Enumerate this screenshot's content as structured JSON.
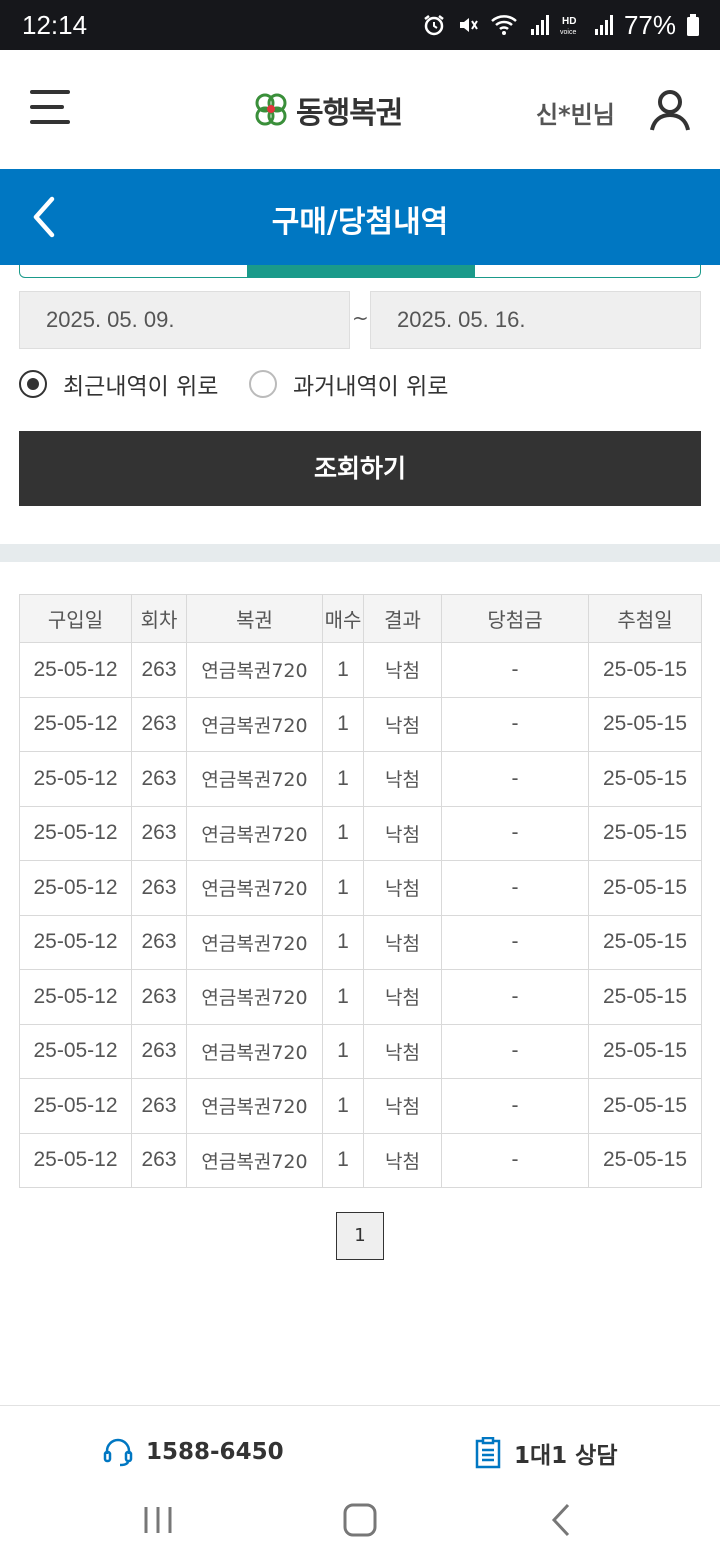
{
  "status_bar": {
    "time": "12:14",
    "battery": "77%"
  },
  "header": {
    "logo_text": "동행복권",
    "user_name": "신*빈님"
  },
  "title_bar": {
    "title": "구매/당첨내역"
  },
  "search": {
    "start_date": "2025. 05. 09.",
    "separator": "~",
    "end_date": "2025. 05. 16.",
    "sort_recent_label": "최근내역이 위로",
    "sort_past_label": "과거내역이 위로",
    "sort_selected": "recent",
    "button_label": "조회하기"
  },
  "table": {
    "headers": [
      "구입일",
      "회차",
      "복권",
      "매수",
      "결과",
      "당첨금",
      "추첨일"
    ],
    "rows": [
      [
        "25-05-12",
        "263",
        "연금복권720",
        "1",
        "낙첨",
        "-",
        "25-05-15"
      ],
      [
        "25-05-12",
        "263",
        "연금복권720",
        "1",
        "낙첨",
        "-",
        "25-05-15"
      ],
      [
        "25-05-12",
        "263",
        "연금복권720",
        "1",
        "낙첨",
        "-",
        "25-05-15"
      ],
      [
        "25-05-12",
        "263",
        "연금복권720",
        "1",
        "낙첨",
        "-",
        "25-05-15"
      ],
      [
        "25-05-12",
        "263",
        "연금복권720",
        "1",
        "낙첨",
        "-",
        "25-05-15"
      ],
      [
        "25-05-12",
        "263",
        "연금복권720",
        "1",
        "낙첨",
        "-",
        "25-05-15"
      ],
      [
        "25-05-12",
        "263",
        "연금복권720",
        "1",
        "낙첨",
        "-",
        "25-05-15"
      ],
      [
        "25-05-12",
        "263",
        "연금복권720",
        "1",
        "낙첨",
        "-",
        "25-05-15"
      ],
      [
        "25-05-12",
        "263",
        "연금복권720",
        "1",
        "낙첨",
        "-",
        "25-05-15"
      ],
      [
        "25-05-12",
        "263",
        "연금복권720",
        "1",
        "낙첨",
        "-",
        "25-05-15"
      ]
    ]
  },
  "pagination": {
    "current_page": "1"
  },
  "footer": {
    "phone": "1588-6450",
    "consult": "1대1 상담"
  },
  "icons": {
    "menu": "menu-icon",
    "user": "user-icon",
    "back": "back-icon",
    "phone": "headset-icon",
    "consult": "clipboard-icon"
  },
  "colors": {
    "title_bar": "#0077c2",
    "tab_accent": "#1a9a8a",
    "button": "#333333",
    "footer_icon": "#0077c2"
  }
}
